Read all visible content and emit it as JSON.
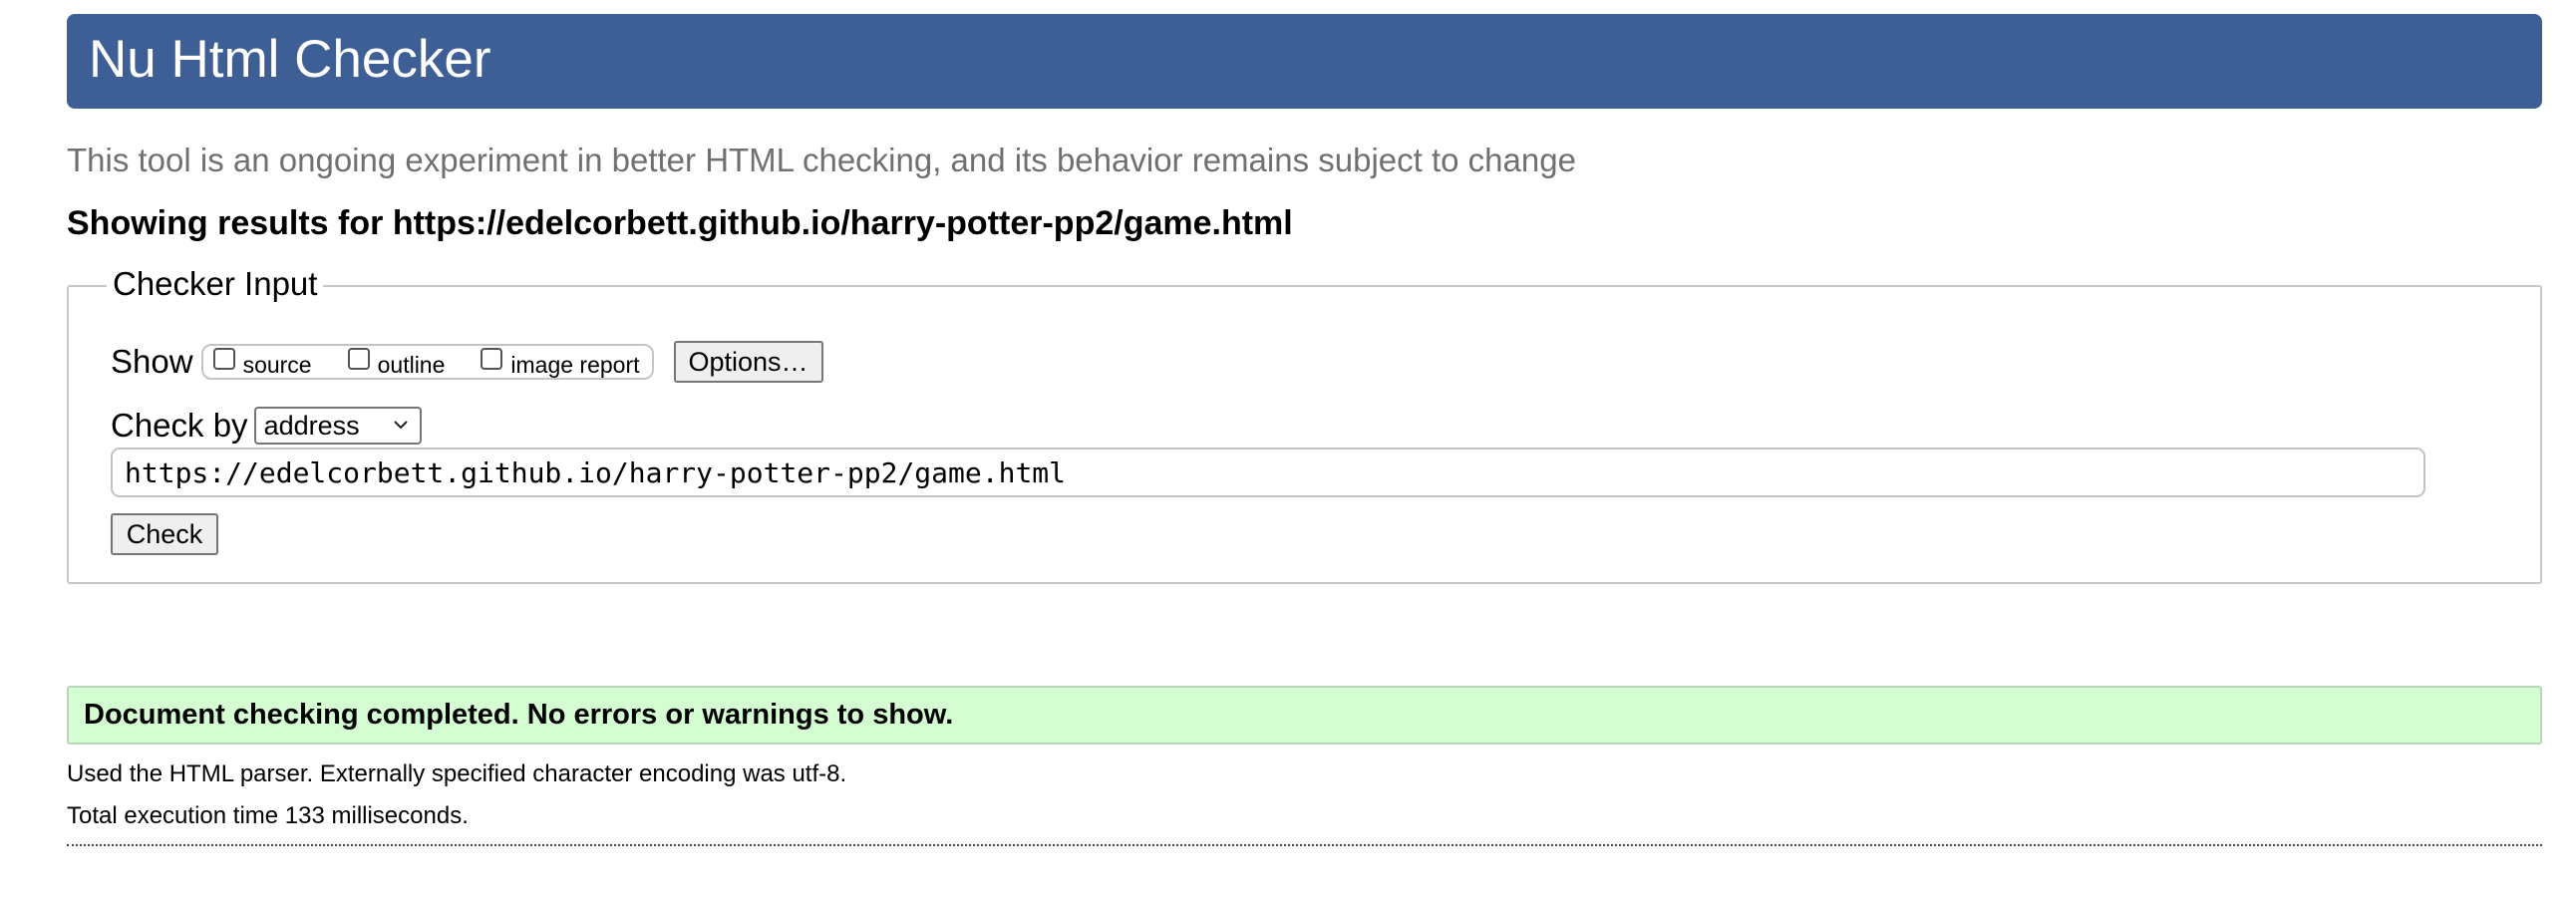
{
  "header": {
    "title": "Nu Html Checker"
  },
  "tagline": "This tool is an ongoing experiment in better HTML checking, and its behavior remains subject to change",
  "showing": {
    "prefix": "Showing results for ",
    "url": "https://edelcorbett.github.io/harry-potter-pp2/game.html"
  },
  "checker_input": {
    "legend": "Checker Input",
    "show_label": "Show",
    "show_options": [
      {
        "label": "source",
        "checked": false
      },
      {
        "label": "outline",
        "checked": false
      },
      {
        "label": "image report",
        "checked": false
      }
    ],
    "options_button": "Options…",
    "check_by_label": "Check by",
    "check_by_selected": "address",
    "url_value": "https://edelcorbett.github.io/harry-potter-pp2/game.html",
    "check_button": "Check"
  },
  "result": {
    "message": "Document checking completed. No errors or warnings to show.",
    "parser_info": "Used the HTML parser. Externally specified character encoding was utf-8.",
    "timing": "Total execution time 133 milliseconds."
  },
  "colors": {
    "header_bg": "#3e5f95",
    "success_bg": "#d5fdd2",
    "tagline": "#707070"
  }
}
